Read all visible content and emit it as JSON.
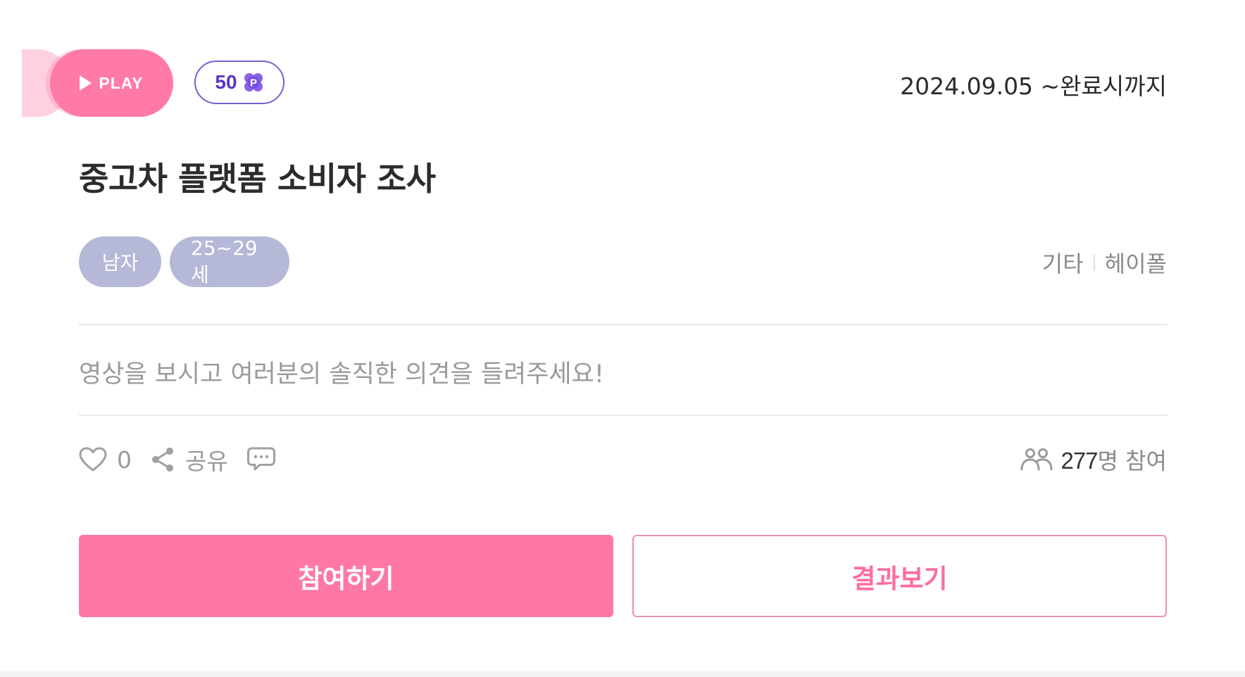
{
  "header": {
    "play_label": "PLAY",
    "points_value": "50",
    "points_icon": "point-coin-icon",
    "period": "2024.09.05 ~완료시까지"
  },
  "survey": {
    "title": "중고차 플랫폼 소비자 조사",
    "tags": [
      "남자",
      "25~29세"
    ],
    "category": "기타",
    "provider": "헤이폴",
    "description": "영상을 보시고 여러분의 솔직한 의견을 들려주세요!"
  },
  "actions": {
    "like_icon": "heart-icon",
    "like_count": "0",
    "share_icon": "share-icon",
    "share_label": "공유",
    "comment_icon": "comment-icon"
  },
  "participants": {
    "icon": "people-icon",
    "count": "277",
    "suffix": "명 참여"
  },
  "buttons": {
    "join_label": "참여하기",
    "result_label": "결과보기"
  },
  "colors": {
    "accent_pink": "#ff78a4",
    "play_pink": "#ff7aa5",
    "points_purple": "#5a34c9",
    "tag_gray": "#b5b8d6"
  }
}
